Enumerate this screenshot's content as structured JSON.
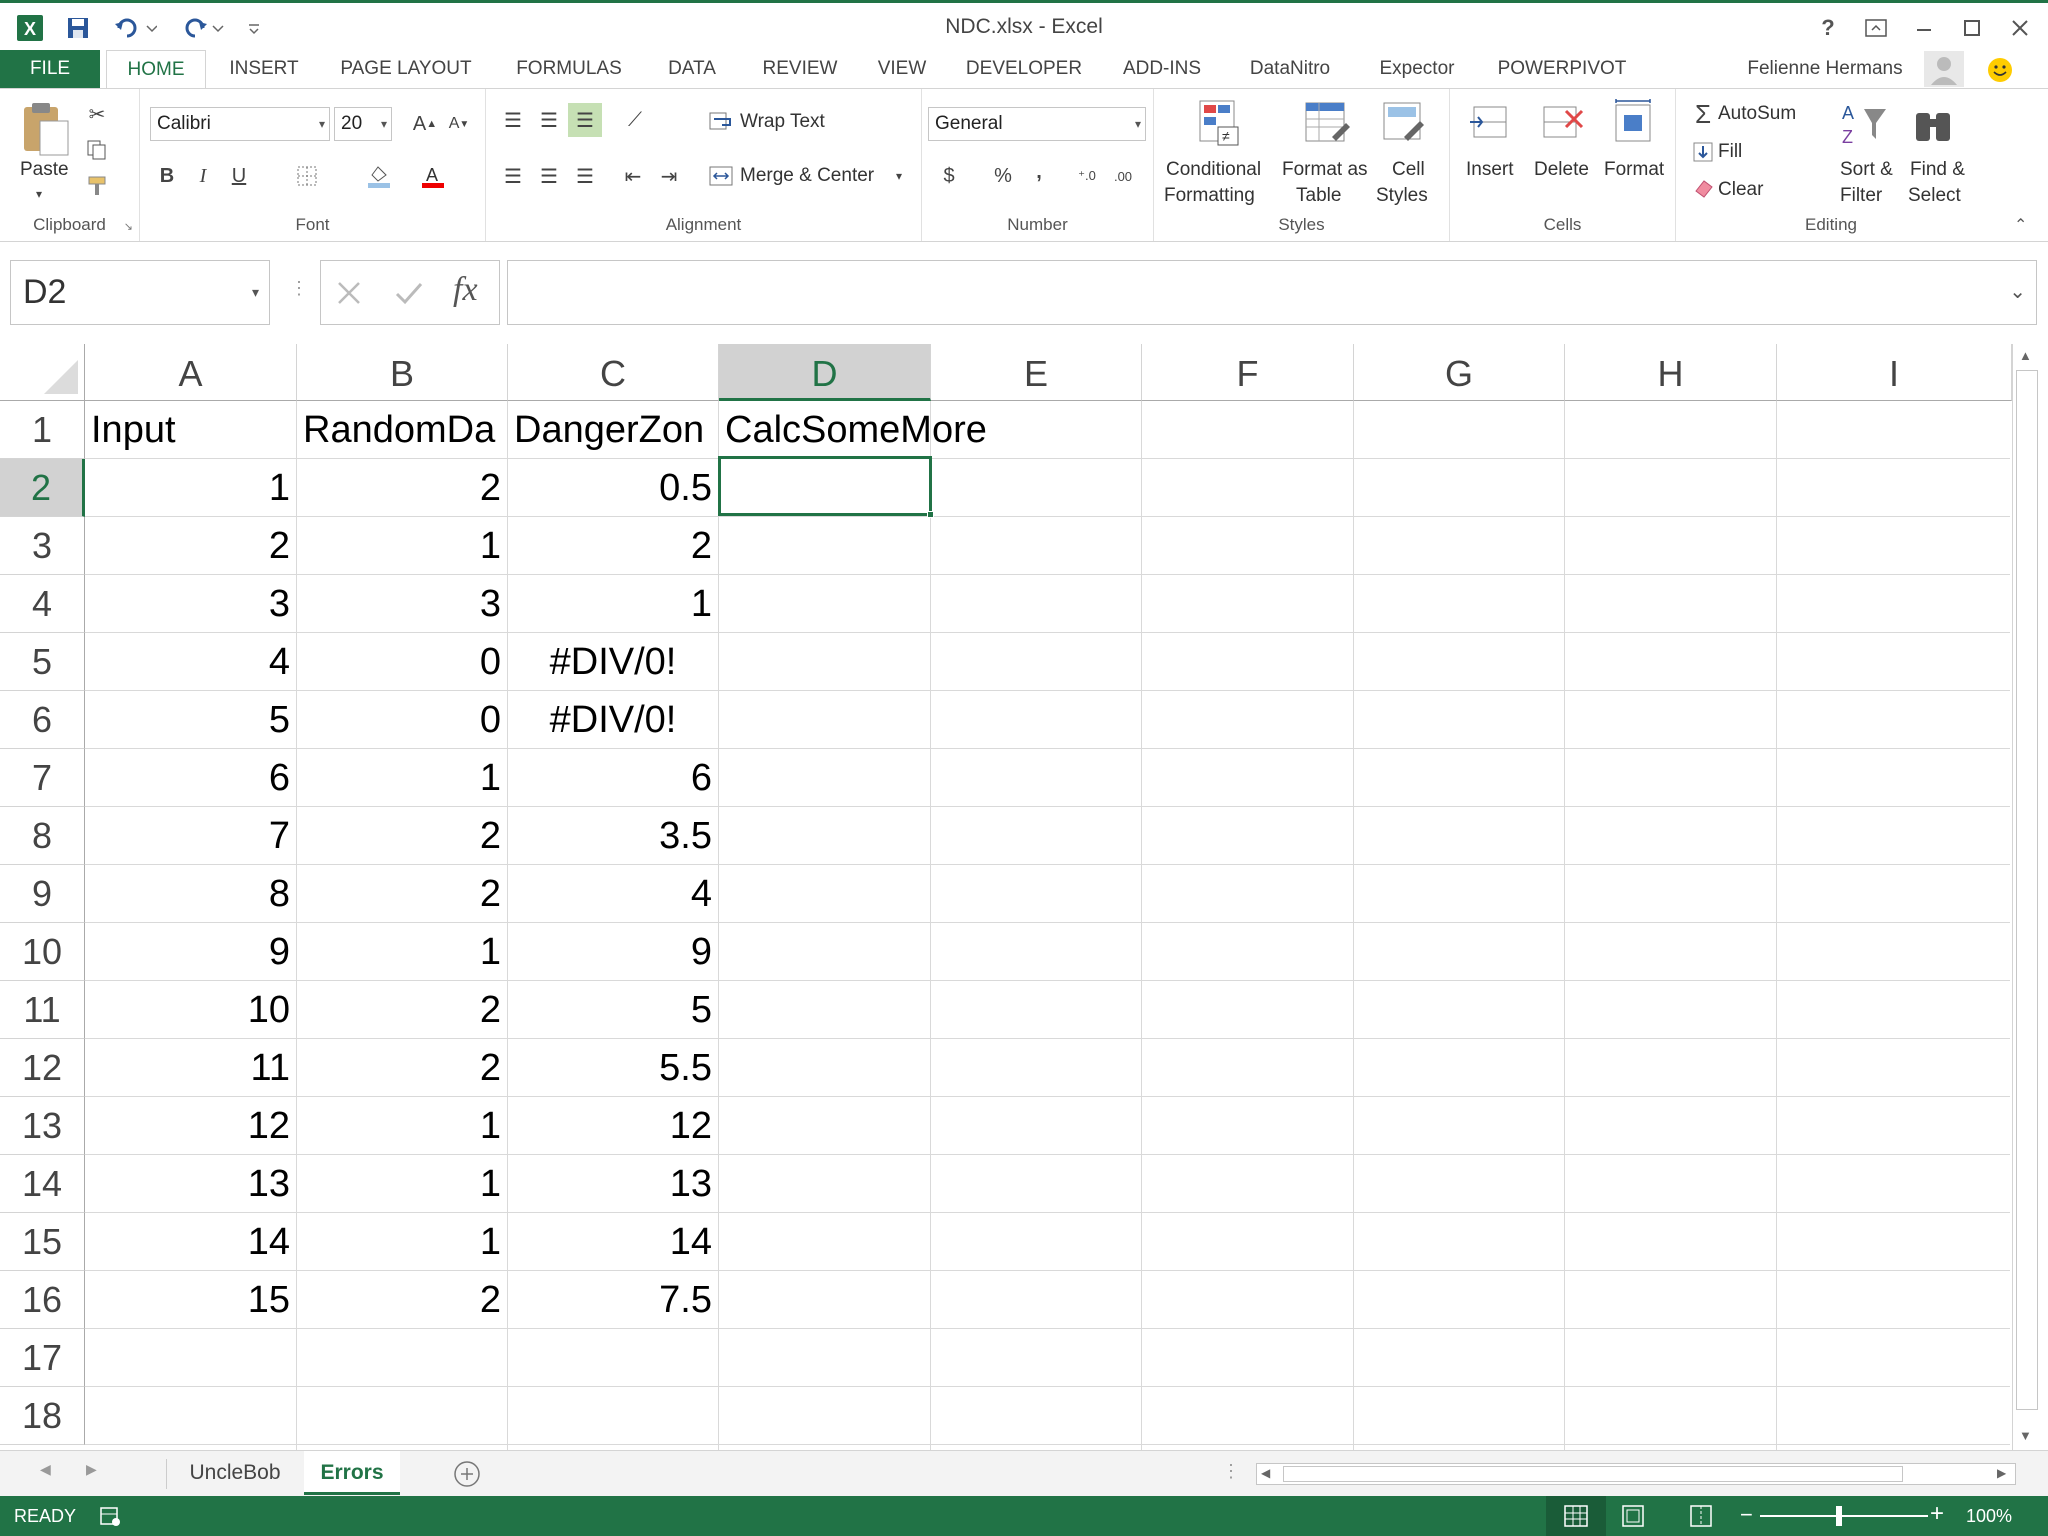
{
  "window": {
    "title": "NDC.xlsx - Excel",
    "help": "?",
    "user": "Felienne Hermans"
  },
  "tabs": [
    "FILE",
    "HOME",
    "INSERT",
    "PAGE LAYOUT",
    "FORMULAS",
    "DATA",
    "REVIEW",
    "VIEW",
    "DEVELOPER",
    "ADD-INS",
    "DataNitro",
    "Expector",
    "POWERPIVOT"
  ],
  "ribbon": {
    "clipboard": {
      "label": "Clipboard",
      "paste": "Paste"
    },
    "font": {
      "label": "Font",
      "name": "Calibri",
      "size": "20",
      "bold": "B",
      "italic": "I",
      "underline": "U"
    },
    "alignment": {
      "label": "Alignment",
      "wrap": "Wrap Text",
      "merge": "Merge & Center"
    },
    "number": {
      "label": "Number",
      "format": "General",
      "currency": "$",
      "percent": "%",
      "comma": ","
    },
    "styles": {
      "label": "Styles",
      "conditional1": "Conditional",
      "conditional2": "Formatting",
      "format_as1": "Format as",
      "format_as2": "Table",
      "cell1": "Cell",
      "cell2": "Styles"
    },
    "cells": {
      "label": "Cells",
      "insert": "Insert",
      "delete": "Delete",
      "format": "Format"
    },
    "editing": {
      "label": "Editing",
      "autosum": "AutoSum",
      "fill": "Fill",
      "clear": "Clear",
      "sort1": "Sort &",
      "sort2": "Filter",
      "find1": "Find &",
      "find2": "Select"
    }
  },
  "formula_bar": {
    "name_box": "D2",
    "fx": "fx",
    "value": ""
  },
  "sheet": {
    "columns": [
      "A",
      "B",
      "C",
      "D",
      "E",
      "F",
      "G",
      "H",
      "I"
    ],
    "selected_column": "D",
    "selected_row": 2,
    "rows": [
      {
        "n": "1",
        "a": "Input",
        "b": "RandomDa",
        "c": "DangerZon",
        "d": "CalcSomeMore"
      },
      {
        "n": "2",
        "a": "1",
        "b": "2",
        "c": "0.5",
        "d": ""
      },
      {
        "n": "3",
        "a": "2",
        "b": "1",
        "c": "2",
        "d": ""
      },
      {
        "n": "4",
        "a": "3",
        "b": "3",
        "c": "1",
        "d": ""
      },
      {
        "n": "5",
        "a": "4",
        "b": "0",
        "c": "#DIV/0!",
        "d": ""
      },
      {
        "n": "6",
        "a": "5",
        "b": "0",
        "c": "#DIV/0!",
        "d": ""
      },
      {
        "n": "7",
        "a": "6",
        "b": "1",
        "c": "6",
        "d": ""
      },
      {
        "n": "8",
        "a": "7",
        "b": "2",
        "c": "3.5",
        "d": ""
      },
      {
        "n": "9",
        "a": "8",
        "b": "2",
        "c": "4",
        "d": ""
      },
      {
        "n": "10",
        "a": "9",
        "b": "1",
        "c": "9",
        "d": ""
      },
      {
        "n": "11",
        "a": "10",
        "b": "2",
        "c": "5",
        "d": ""
      },
      {
        "n": "12",
        "a": "11",
        "b": "2",
        "c": "5.5",
        "d": ""
      },
      {
        "n": "13",
        "a": "12",
        "b": "1",
        "c": "12",
        "d": ""
      },
      {
        "n": "14",
        "a": "13",
        "b": "1",
        "c": "13",
        "d": ""
      },
      {
        "n": "15",
        "a": "14",
        "b": "1",
        "c": "14",
        "d": ""
      },
      {
        "n": "16",
        "a": "15",
        "b": "2",
        "c": "7.5",
        "d": ""
      },
      {
        "n": "17",
        "a": "",
        "b": "",
        "c": "",
        "d": ""
      },
      {
        "n": "18",
        "a": "",
        "b": "",
        "c": "",
        "d": ""
      }
    ]
  },
  "sheet_tabs": {
    "tabs": [
      "UncleBob",
      "Errors"
    ],
    "active": "Errors"
  },
  "status": {
    "state": "READY",
    "zoom": "100%"
  },
  "colors": {
    "accent": "#217346",
    "file_tab": "#217346"
  }
}
